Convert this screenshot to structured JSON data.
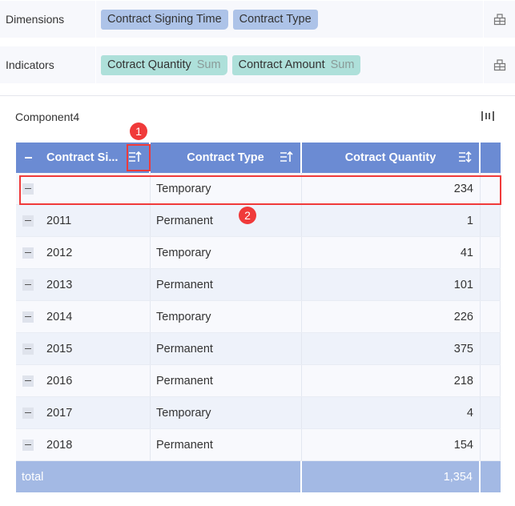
{
  "dimensions": {
    "label": "Dimensions",
    "chips": [
      "Contract Signing Time",
      "Contract Type"
    ]
  },
  "indicators": {
    "label": "Indicators",
    "chips": [
      {
        "name": "Cotract Quantity",
        "agg": "Sum"
      },
      {
        "name": "Contract Amount",
        "agg": "Sum"
      }
    ]
  },
  "component": {
    "title": "Component4"
  },
  "table": {
    "headers": [
      "Contract Si...",
      "Contract Type",
      "Cotract Quantity"
    ],
    "rows": [
      {
        "year": "",
        "type": "Temporary",
        "qty": "234"
      },
      {
        "year": "2011",
        "type": "Permanent",
        "qty": "1"
      },
      {
        "year": "2012",
        "type": "Temporary",
        "qty": "41"
      },
      {
        "year": "2013",
        "type": "Permanent",
        "qty": "101"
      },
      {
        "year": "2014",
        "type": "Temporary",
        "qty": "226"
      },
      {
        "year": "2015",
        "type": "Permanent",
        "qty": "375"
      },
      {
        "year": "2016",
        "type": "Permanent",
        "qty": "218"
      },
      {
        "year": "2017",
        "type": "Temporary",
        "qty": "4"
      },
      {
        "year": "2018",
        "type": "Permanent",
        "qty": "154"
      }
    ],
    "total_label": "total",
    "total_value": "1,354"
  },
  "annotations": [
    "1",
    "2"
  ],
  "colors": {
    "header": "#6b8bd3",
    "total": "#a3b9e4",
    "dim_chip": "#adc3e8",
    "ind_chip": "#aee0da",
    "marker": "#f03a3a"
  }
}
